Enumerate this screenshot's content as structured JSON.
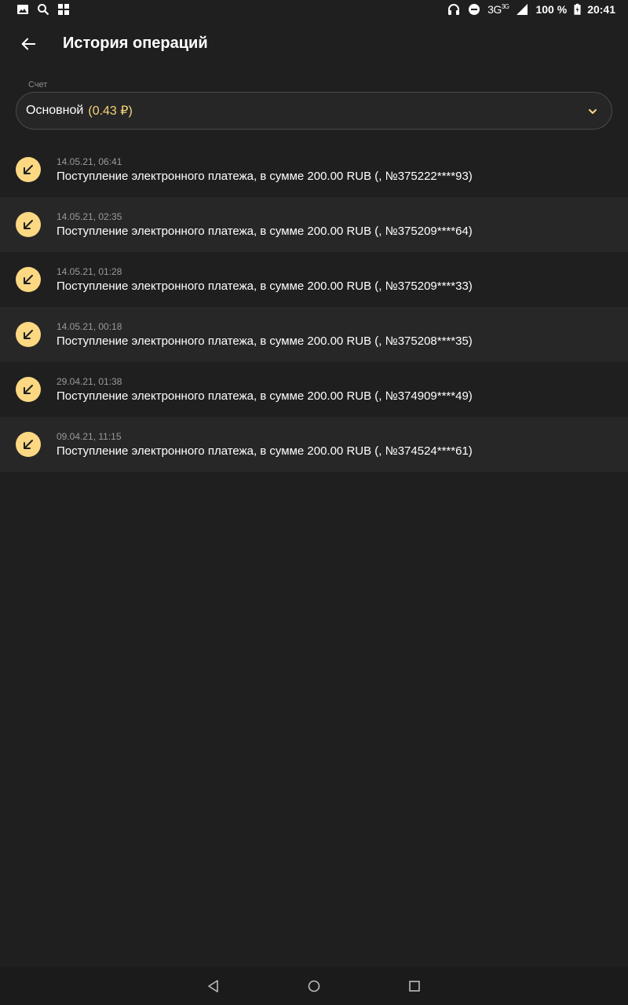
{
  "status_bar": {
    "network": "3G",
    "network_sup": "3G",
    "battery": "100 %",
    "time": "20:41",
    "left_icons": [
      "image-icon",
      "search-icon",
      "store-icon"
    ],
    "right_icons": [
      "headphones-icon",
      "do-not-disturb-icon",
      "signal-icon",
      "battery-icon"
    ]
  },
  "header": {
    "title": "История операций"
  },
  "account": {
    "label": "Счет",
    "name": "Основной",
    "balance": "(0.43 ₽)",
    "balance_color": "#f7d47a"
  },
  "transactions": [
    {
      "date": "14.05.21, 06:41",
      "description": "Поступление электронного платежа, в сумме 200.00 RUB (,  №375222****93)"
    },
    {
      "date": "14.05.21, 02:35",
      "description": "Поступление электронного платежа, в сумме 200.00 RUB (,  №375209****64)"
    },
    {
      "date": "14.05.21, 01:28",
      "description": "Поступление электронного платежа, в сумме 200.00 RUB (,  №375209****33)"
    },
    {
      "date": "14.05.21, 00:18",
      "description": "Поступление электронного платежа, в сумме 200.00 RUB (,  №375208****35)"
    },
    {
      "date": "29.04.21, 01:38",
      "description": "Поступление электронного платежа, в сумме 200.00 RUB (,  №374909****49)"
    },
    {
      "date": "09.04.21, 11:15",
      "description": "Поступление электронного платежа, в сумме 200.00 RUB (,  №374524****61)"
    }
  ],
  "colors": {
    "accent": "#fcd883",
    "background": "#1f1f1f",
    "row_alt": "#272727"
  }
}
